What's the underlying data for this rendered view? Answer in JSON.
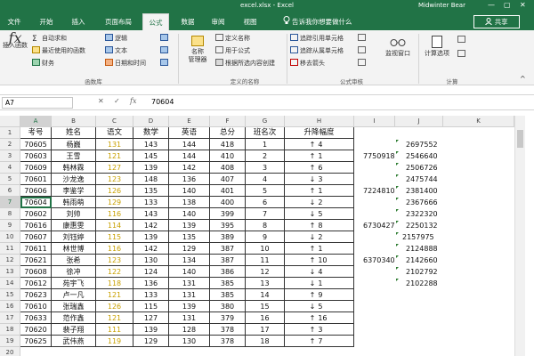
{
  "window": {
    "title": "excel.xlsx - Excel",
    "user": "Midwinter Bear",
    "minimize": "—",
    "restore": "▢",
    "close": "✕"
  },
  "tabs": [
    "文件",
    "开始",
    "插入",
    "页面布局",
    "公式",
    "数据",
    "审阅",
    "视图"
  ],
  "active_tab": "公式",
  "search_hint": "告诉我你想要做什么",
  "share_label": "共享",
  "ribbon": {
    "insert_function": "插入函数",
    "autosum": "自动求和",
    "recent": "最近使用的函数",
    "financial": "财务",
    "logical": "逻辑",
    "text": "文本",
    "datetime": "日期和时间",
    "group_library": "函数库",
    "name_manager": "名称\n管理器",
    "define_name": "定义名称",
    "use_in_formula": "用于公式",
    "create_from_selection": "根据所选内容创建",
    "group_names": "定义的名称",
    "trace_precedents": "追踪引用单元格",
    "trace_dependents": "追踪从属单元格",
    "remove_arrows": "移去箭头",
    "watch_window": "监视窗口",
    "group_audit": "公式审核",
    "calc_options": "计算选项",
    "group_calc": "计算"
  },
  "formula_bar": {
    "name_box": "A7",
    "cancel": "✕",
    "enter": "✓",
    "fx": "fx",
    "value": "70604"
  },
  "columns": [
    "A",
    "B",
    "C",
    "D",
    "E",
    "F",
    "G",
    "H",
    "I",
    "J",
    "K"
  ],
  "rows": [
    "1",
    "2",
    "3",
    "4",
    "5",
    "6",
    "7",
    "8",
    "9",
    "10",
    "11",
    "12",
    "13",
    "14",
    "15",
    "16",
    "17",
    "18",
    "19",
    "20",
    "21"
  ],
  "table_headers": [
    "考号",
    "姓名",
    "语文",
    "数学",
    "英语",
    "总分",
    "班名次",
    "升降幅度"
  ],
  "table_rows": [
    {
      "id": "70605",
      "name": "杨巍",
      "chinese": "131",
      "math": "143",
      "english": "144",
      "total": "418",
      "rank": "1",
      "arrow": "↑",
      "change": "4"
    },
    {
      "id": "70603",
      "name": "王雪",
      "chinese": "121",
      "math": "145",
      "english": "144",
      "total": "410",
      "rank": "2",
      "arrow": "↑",
      "change": "1"
    },
    {
      "id": "70609",
      "name": "韩林霖",
      "chinese": "127",
      "math": "139",
      "english": "142",
      "total": "408",
      "rank": "3",
      "arrow": "↑",
      "change": "6"
    },
    {
      "id": "70601",
      "name": "沙龙逸",
      "chinese": "123",
      "math": "148",
      "english": "136",
      "total": "407",
      "rank": "4",
      "arrow": "↓",
      "change": "3"
    },
    {
      "id": "70606",
      "name": "李鉴学",
      "chinese": "126",
      "math": "135",
      "english": "140",
      "total": "401",
      "rank": "5",
      "arrow": "↑",
      "change": "1"
    },
    {
      "id": "70604",
      "name": "韩雨萌",
      "chinese": "129",
      "math": "133",
      "english": "138",
      "total": "400",
      "rank": "6",
      "arrow": "↓",
      "change": "2"
    },
    {
      "id": "70602",
      "name": "刘帅",
      "chinese": "116",
      "math": "143",
      "english": "140",
      "total": "399",
      "rank": "7",
      "arrow": "↓",
      "change": "5"
    },
    {
      "id": "70616",
      "name": "康惠雯",
      "chinese": "114",
      "math": "142",
      "english": "139",
      "total": "395",
      "rank": "8",
      "arrow": "↑",
      "change": "8"
    },
    {
      "id": "70607",
      "name": "刘钰婷",
      "chinese": "115",
      "math": "139",
      "english": "135",
      "total": "389",
      "rank": "9",
      "arrow": "↓",
      "change": "2"
    },
    {
      "id": "70611",
      "name": "林世博",
      "chinese": "116",
      "math": "142",
      "english": "129",
      "total": "387",
      "rank": "10",
      "arrow": "↑",
      "change": "1"
    },
    {
      "id": "70621",
      "name": "张希",
      "chinese": "123",
      "math": "130",
      "english": "134",
      "total": "387",
      "rank": "11",
      "arrow": "↑",
      "change": "10"
    },
    {
      "id": "70608",
      "name": "徐冲",
      "chinese": "122",
      "math": "124",
      "english": "140",
      "total": "386",
      "rank": "12",
      "arrow": "↓",
      "change": "4"
    },
    {
      "id": "70612",
      "name": "苑宇飞",
      "chinese": "118",
      "math": "136",
      "english": "131",
      "total": "385",
      "rank": "13",
      "arrow": "↓",
      "change": "1"
    },
    {
      "id": "70623",
      "name": "卢一凡",
      "chinese": "121",
      "math": "133",
      "english": "131",
      "total": "385",
      "rank": "14",
      "arrow": "↑",
      "change": "9"
    },
    {
      "id": "70610",
      "name": "张瑞鑫",
      "chinese": "126",
      "math": "115",
      "english": "139",
      "total": "380",
      "rank": "15",
      "arrow": "↓",
      "change": "5"
    },
    {
      "id": "70633",
      "name": "范作鑫",
      "chinese": "121",
      "math": "127",
      "english": "131",
      "total": "379",
      "rank": "16",
      "arrow": "↑",
      "change": "16"
    },
    {
      "id": "70620",
      "name": "裴子翔",
      "chinese": "111",
      "math": "139",
      "english": "128",
      "total": "378",
      "rank": "17",
      "arrow": "↑",
      "change": "3"
    },
    {
      "id": "70625",
      "name": "武伟燕",
      "chinese": "119",
      "math": "129",
      "english": "130",
      "total": "378",
      "rank": "18",
      "arrow": "↑",
      "change": "7"
    }
  ],
  "col_i": [
    {
      "row": 3,
      "value": "7750918"
    },
    {
      "row": 6,
      "value": "7224810"
    },
    {
      "row": 9,
      "value": "6730427"
    },
    {
      "row": 12,
      "value": "6370340"
    }
  ],
  "col_j": [
    "2697552",
    "2546640",
    "2506726",
    "2475744",
    "2381400",
    "2367666",
    "2322320",
    "2250132",
    "2157975",
    "2124888",
    "2142660",
    "2102792",
    "2102288"
  ],
  "colors": {
    "excel_green": "#217346",
    "score_yellow": "#c8a000"
  }
}
